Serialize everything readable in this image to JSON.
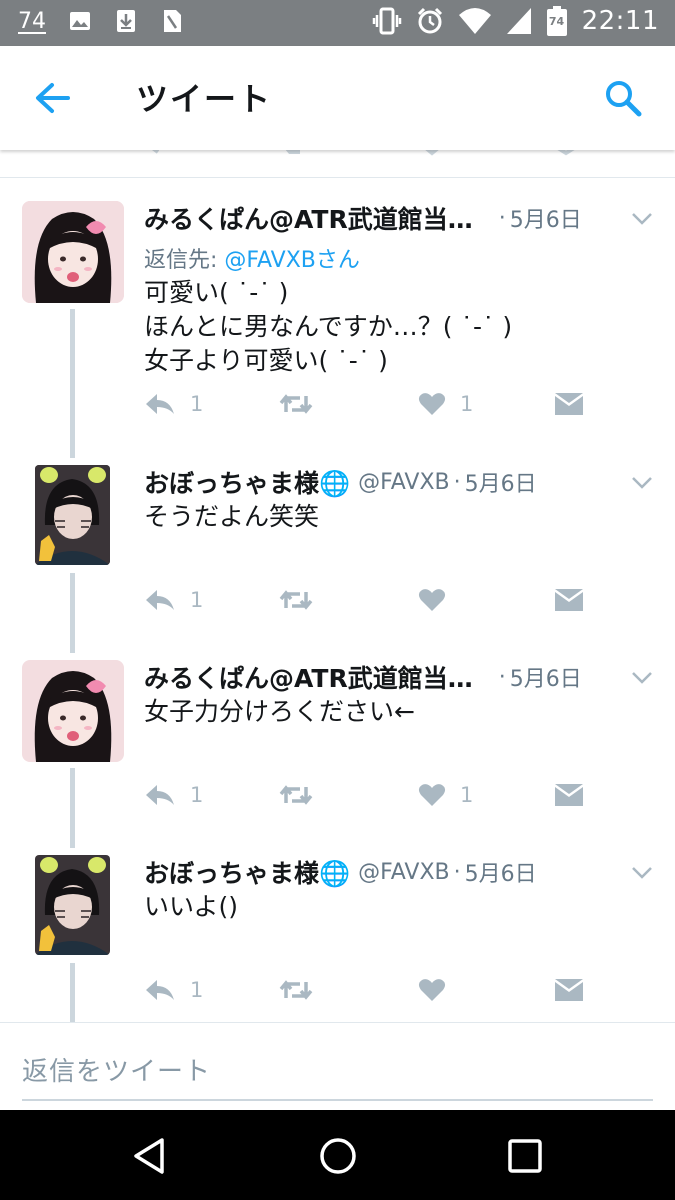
{
  "status_bar": {
    "notification_count": "74",
    "battery_level": "74",
    "time": "22:11"
  },
  "app_bar": {
    "title": "ツイート",
    "back_icon": "arrow-left-icon",
    "search_icon": "search-icon"
  },
  "tweets": [
    {
      "name": "みるくぱん@ATR武道館当…",
      "handle": "",
      "date": "5月6日",
      "reply_prefix": "返信先: ",
      "reply_to": "@FAVXBさん",
      "text": "可愛い( ˙-˙ )\nほんとに男なんですか…？( ˙-˙ )\n女子より可愛い( ˙-˙ )",
      "reply_count": "1",
      "retweet_count": "",
      "like_count": "1"
    },
    {
      "name": "おぼっちゃま様🌐",
      "handle": "@FAVXB",
      "date": "5月6日",
      "text": "そうだよん笑笑",
      "reply_count": "1",
      "retweet_count": "",
      "like_count": ""
    },
    {
      "name": "みるくぱん@ATR武道館当…",
      "handle": "",
      "date": "5月6日",
      "text": "女子力分けろください←",
      "reply_count": "1",
      "retweet_count": "",
      "like_count": "1"
    },
    {
      "name": "おぼっちゃま様🌐",
      "handle": "@FAVXB",
      "date": "5月6日",
      "text": "いいよ()",
      "reply_count": "1",
      "retweet_count": "",
      "like_count": ""
    }
  ],
  "composer": {
    "placeholder": "返信をツイート"
  },
  "colors": {
    "accent": "#1da1f2",
    "muted": "#657786",
    "icon_gray": "#aab8c2",
    "status_bar": "#7b7f82"
  }
}
